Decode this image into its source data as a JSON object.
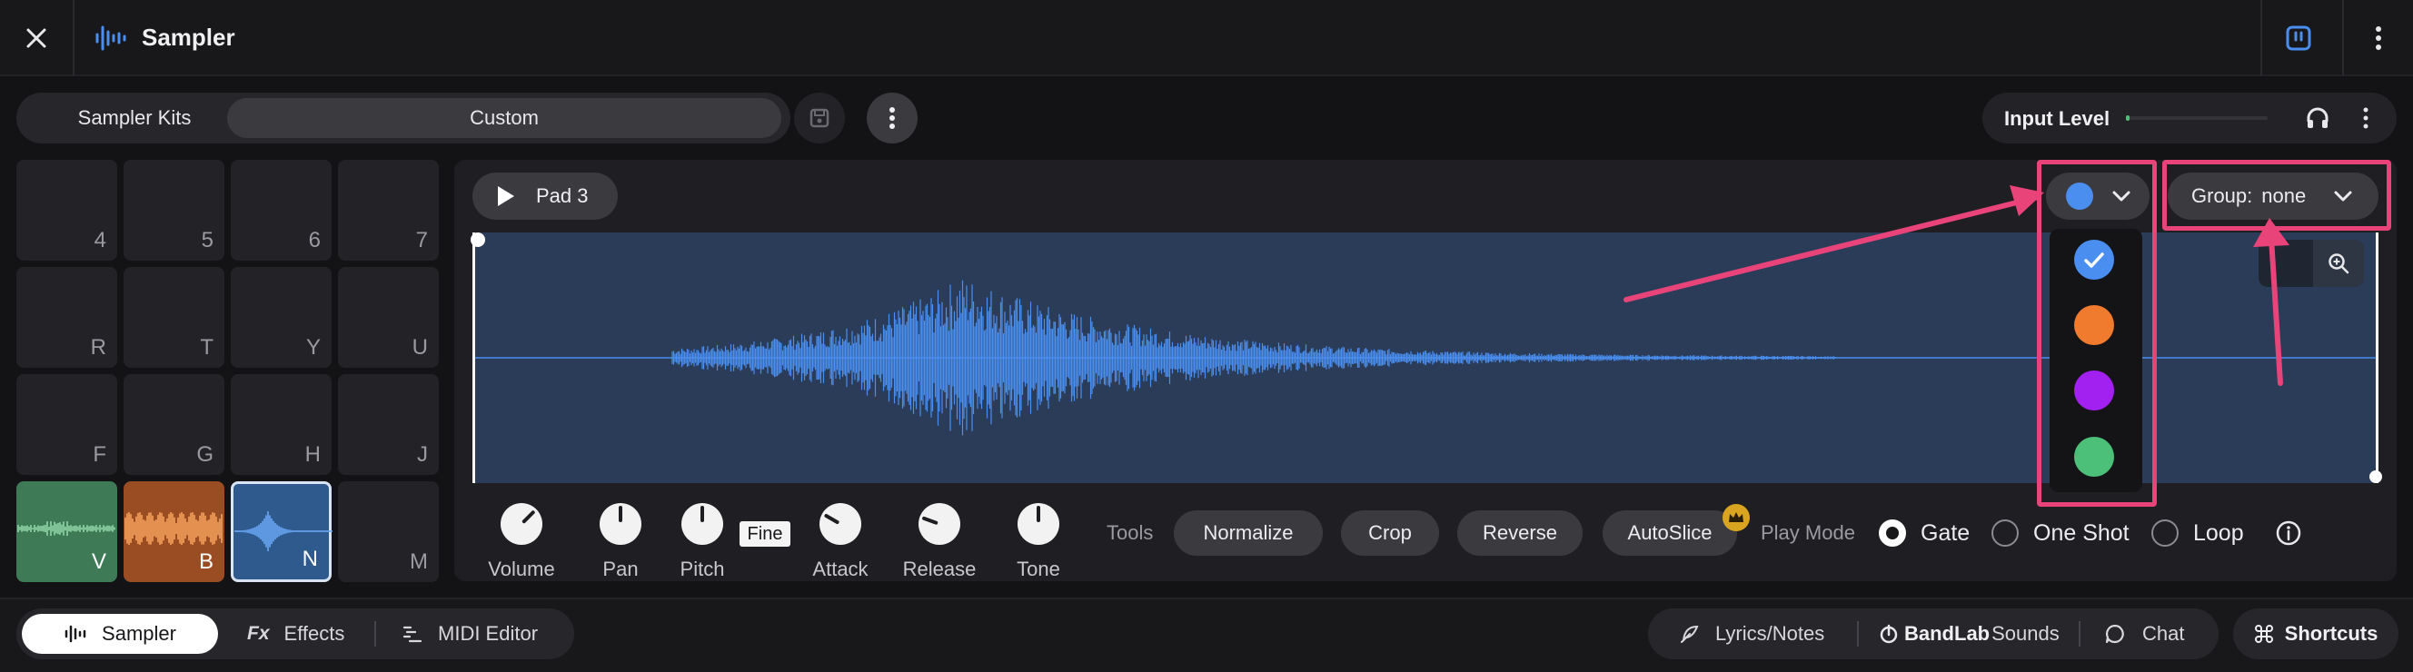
{
  "header": {
    "title": "Sampler"
  },
  "toolbar": {
    "sampler_kits_label": "Sampler Kits",
    "custom_label": "Custom",
    "input_level_label": "Input Level"
  },
  "pads": [
    {
      "key": "4",
      "color": "#232327"
    },
    {
      "key": "5",
      "color": "#232327"
    },
    {
      "key": "6",
      "color": "#232327"
    },
    {
      "key": "7",
      "color": "#232327"
    },
    {
      "key": "R",
      "color": "#232327"
    },
    {
      "key": "T",
      "color": "#232327"
    },
    {
      "key": "Y",
      "color": "#232327"
    },
    {
      "key": "U",
      "color": "#232327"
    },
    {
      "key": "F",
      "color": "#232327"
    },
    {
      "key": "G",
      "color": "#232327"
    },
    {
      "key": "H",
      "color": "#232327"
    },
    {
      "key": "J",
      "color": "#232327"
    },
    {
      "key": "V",
      "color": "#3d7a55"
    },
    {
      "key": "B",
      "color": "#9a4c22"
    },
    {
      "key": "N",
      "color": "#2f5a8e"
    },
    {
      "key": "M",
      "color": "#232327"
    }
  ],
  "editor": {
    "pad_name": "Pad 3",
    "group_label": "Group:",
    "group_value": "none",
    "selected_color": "#4a8ef0",
    "color_options": [
      "#4a8ef0",
      "#f07a2e",
      "#a321f0",
      "#4cbf78"
    ],
    "fine_label": "Fine",
    "knobs": [
      {
        "label": "Volume"
      },
      {
        "label": "Pan"
      },
      {
        "label": "Pitch"
      },
      {
        "label": "Attack"
      },
      {
        "label": "Release"
      },
      {
        "label": "Tone"
      }
    ],
    "tools_label": "Tools",
    "tools": [
      "Normalize",
      "Crop",
      "Reverse",
      "AutoSlice"
    ],
    "play_mode_label": "Play Mode",
    "play_modes": [
      {
        "label": "Gate",
        "selected": true
      },
      {
        "label": "One Shot",
        "selected": false
      },
      {
        "label": "Loop",
        "selected": false
      }
    ]
  },
  "bottom": {
    "sampler_tab": "Sampler",
    "effects_tab": "Effects",
    "midi_editor_tab": "MIDI Editor",
    "lyrics_notes": "Lyrics/Notes",
    "bandlab_sounds_brand": "BandLab",
    "bandlab_sounds_suffix": "Sounds",
    "chat": "Chat",
    "shortcuts": "Shortcuts",
    "fx_glyph": "Fx"
  },
  "colors": {
    "accent_blue": "#4a8ef0",
    "annotation_pink": "#e8447a",
    "waveform_bg": "#2a3c58"
  }
}
